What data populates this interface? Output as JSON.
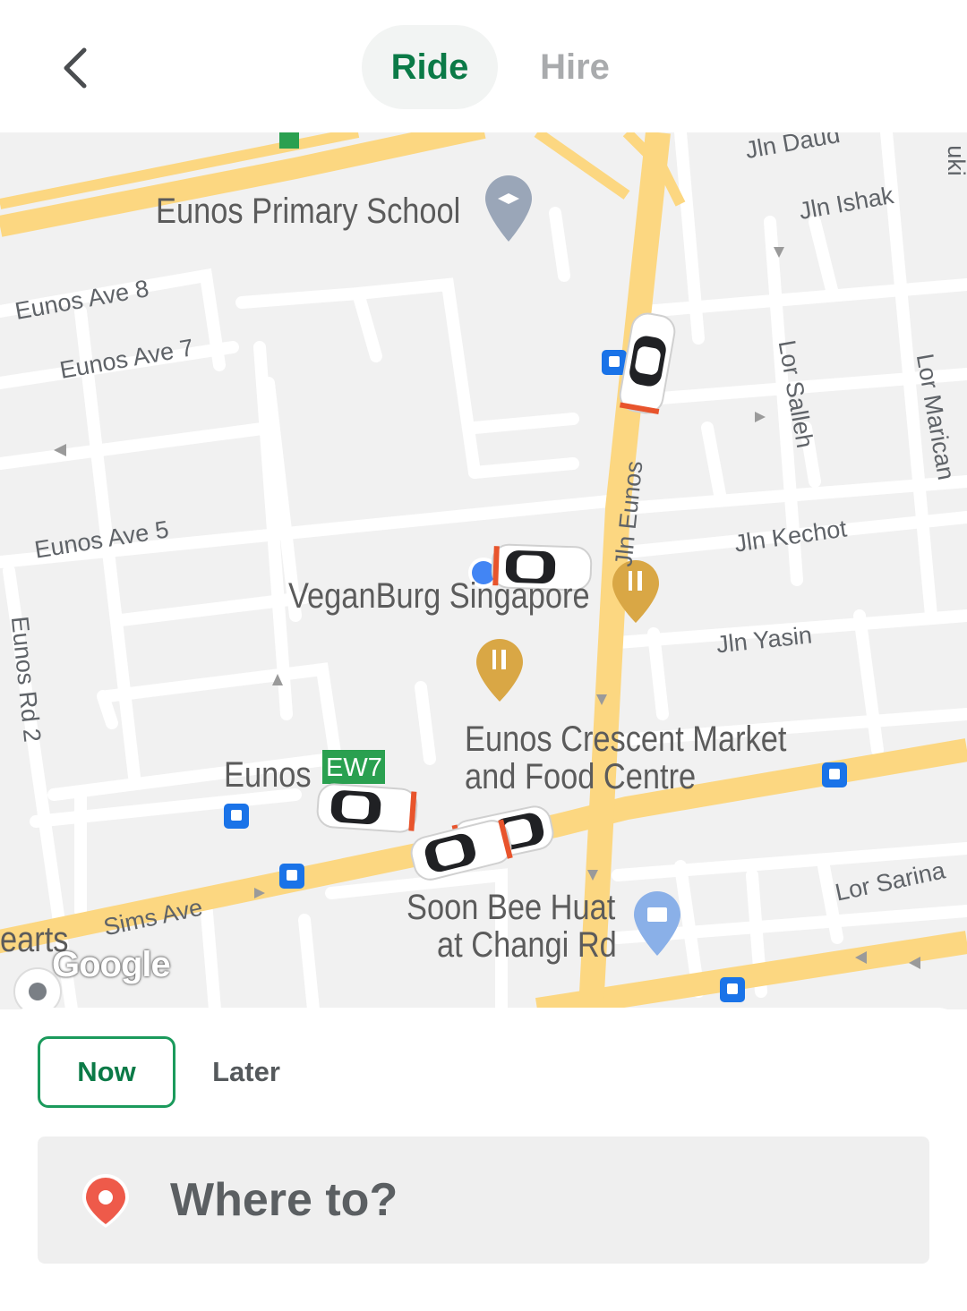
{
  "header": {
    "back_icon": "chevron-left-icon",
    "tabs": [
      {
        "label": "Ride",
        "active": true
      },
      {
        "label": "Hire",
        "active": false
      }
    ],
    "accent_color": "#0b7a47"
  },
  "map": {
    "pois": {
      "school": "Eunos Primary School",
      "veganburg": "VeganBurg Singapore",
      "market_line1": "Eunos Crescent Market",
      "market_line2": "and Food Centre",
      "soonbee_line1": "Soon Bee Huat",
      "soonbee_line2": "at Changi Rd",
      "station": "Eunos",
      "station_code": "EW7",
      "partial": "earts"
    },
    "streets": {
      "eunos_ave_8": "Eunos Ave 8",
      "eunos_ave_7": "Eunos Ave 7",
      "eunos_ave_5": "Eunos Ave 5",
      "eunos_rd_2": "Eunos Rd 2",
      "sims_ave": "Sims Ave",
      "jln_eunos": "Jln Eunos",
      "jln_daud": "Jln Daud",
      "jln_ishak": "Jln Ishak",
      "lor_salleh": "Lor Salleh",
      "lor_marican": "Lor Marican",
      "jln_kechot": "Jln Kechot",
      "jln_yasin": "Jln Yasin",
      "lor_sarina": "Lor Sarina",
      "edge": "uki"
    },
    "attribution": "Google"
  },
  "booking": {
    "now_label": "Now",
    "later_label": "Later",
    "destination_placeholder": "Where to?",
    "destination_icon": "location-pin-icon"
  }
}
